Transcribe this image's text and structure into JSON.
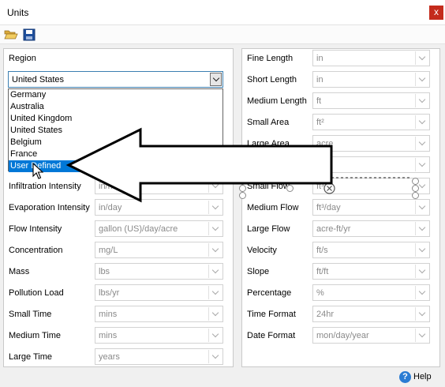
{
  "window": {
    "title": "Units",
    "close_label": "x"
  },
  "toolbar": {
    "open_icon": "open-folder-icon",
    "save_icon": "save-disk-icon"
  },
  "region": {
    "label": "Region",
    "selected": "United States",
    "options": [
      "Germany",
      "Australia",
      "United Kingdom",
      "United States",
      "Belgium",
      "France",
      "User Defined"
    ],
    "highlighted": "User Defined"
  },
  "left_fields": [
    {
      "label": "Infiltration Intensity",
      "value": "in/hr"
    },
    {
      "label": "Evaporation Intensity",
      "value": "in/day"
    },
    {
      "label": "Flow Intensity",
      "value": "gallon (US)/day/acre"
    },
    {
      "label": "Concentration",
      "value": "mg/L"
    },
    {
      "label": "Mass",
      "value": "lbs"
    },
    {
      "label": "Pollution Load",
      "value": "lbs/yr"
    },
    {
      "label": "Small Time",
      "value": "mins"
    },
    {
      "label": "Medium Time",
      "value": "mins"
    },
    {
      "label": "Large Time",
      "value": "years"
    }
  ],
  "right_fields": [
    {
      "label": "Fine Length",
      "value": "in"
    },
    {
      "label": "Short Length",
      "value": "in"
    },
    {
      "label": "Medium Length",
      "value": "ft"
    },
    {
      "label": "Small Area",
      "value": "ft²"
    },
    {
      "label": "Large Area",
      "value": "acre"
    },
    {
      "label": "",
      "value": ""
    },
    {
      "label": "Small Flow",
      "value": "ft³"
    },
    {
      "label": "Medium Flow",
      "value": "ft³/day"
    },
    {
      "label": "Large Flow",
      "value": "acre-ft/yr"
    },
    {
      "label": "Velocity",
      "value": "ft/s"
    },
    {
      "label": "Slope",
      "value": "ft/ft"
    },
    {
      "label": "Percentage",
      "value": "%"
    },
    {
      "label": "Time Format",
      "value": "24hr"
    },
    {
      "label": "Date Format",
      "value": "mon/day/year"
    }
  ],
  "help": {
    "label": "Help",
    "icon": "help-icon"
  },
  "colors": {
    "selection": "#0078d7",
    "close": "#c42b1c",
    "focus_border": "#3c7fb1"
  }
}
